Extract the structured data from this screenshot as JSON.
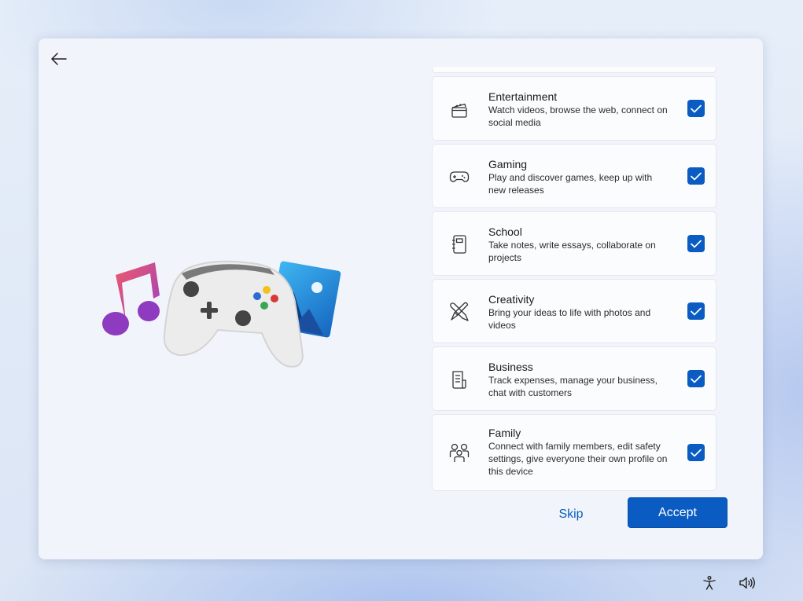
{
  "categories": [
    {
      "title": "Entertainment",
      "desc": "Watch videos, browse the web, connect on social media",
      "icon": "clapperboard-icon",
      "checked": true
    },
    {
      "title": "Gaming",
      "desc": "Play and discover games, keep up with new releases",
      "icon": "gamepad-icon",
      "checked": true
    },
    {
      "title": "School",
      "desc": "Take notes, write essays, collaborate on projects",
      "icon": "notebook-icon",
      "checked": true
    },
    {
      "title": "Creativity",
      "desc": "Bring your ideas to life with photos and videos",
      "icon": "pen-brush-icon",
      "checked": true
    },
    {
      "title": "Business",
      "desc": "Track expenses, manage your business, chat with customers",
      "icon": "document-icon",
      "checked": true
    },
    {
      "title": "Family",
      "desc": "Connect with family members, edit safety settings, give everyone their own profile on this device",
      "icon": "people-icon",
      "checked": true
    }
  ],
  "actions": {
    "skip_label": "Skip",
    "accept_label": "Accept"
  },
  "colors": {
    "accent": "#0a5cc2",
    "card": "#fbfcfe",
    "window": "#f1f5fb"
  },
  "taskbar": {
    "icons": [
      "accessibility-icon",
      "volume-icon"
    ]
  }
}
